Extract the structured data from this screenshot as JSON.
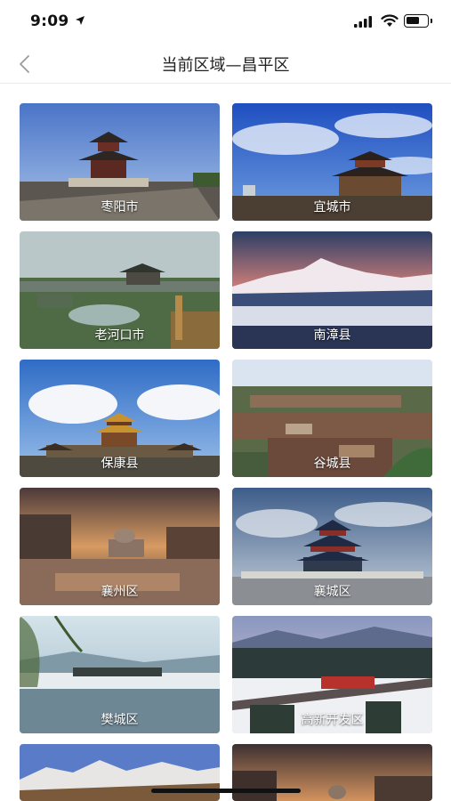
{
  "status_bar": {
    "time": "9:09"
  },
  "nav": {
    "title": "当前区域—昌平区"
  },
  "regions": [
    {
      "name": "枣阳市"
    },
    {
      "name": "宜城市"
    },
    {
      "name": "老河口市"
    },
    {
      "name": "南漳县"
    },
    {
      "name": "保康县"
    },
    {
      "name": "谷城县"
    },
    {
      "name": "襄州区"
    },
    {
      "name": "襄城区"
    },
    {
      "name": "樊城区"
    },
    {
      "name": "高新开发区"
    },
    {
      "name": ""
    },
    {
      "name": ""
    }
  ]
}
